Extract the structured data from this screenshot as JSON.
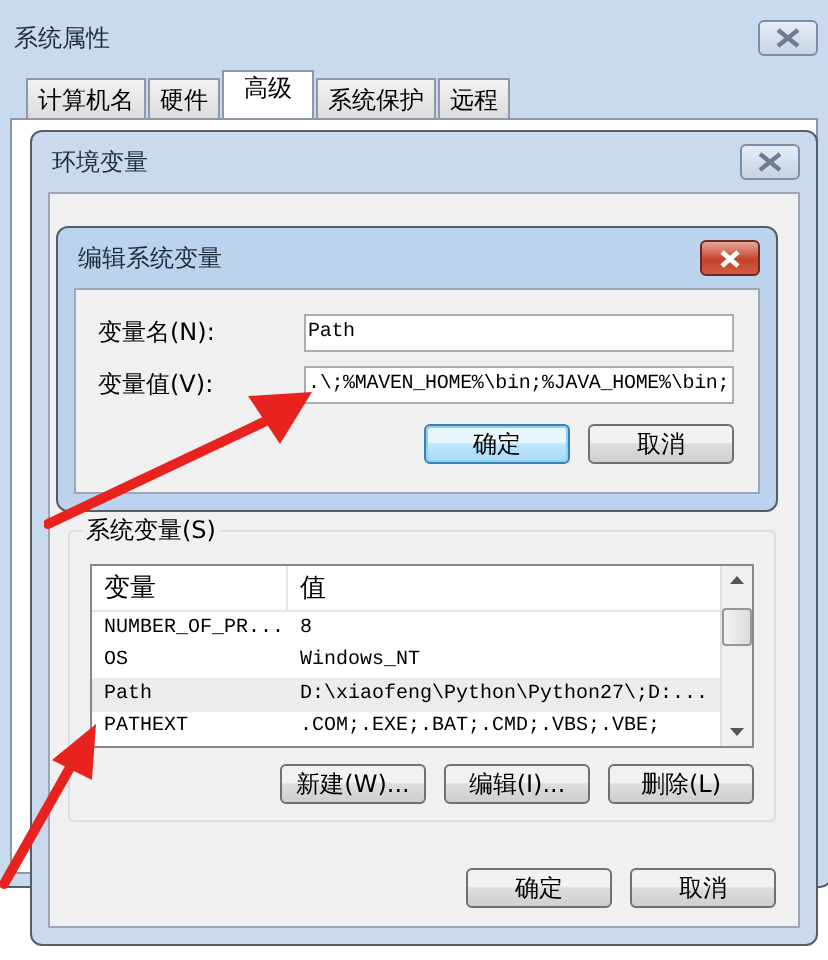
{
  "window": {
    "title": "系统属性"
  },
  "tabs": [
    {
      "label": "计算机名",
      "selected": false
    },
    {
      "label": "硬件",
      "selected": false
    },
    {
      "label": "高级",
      "selected": true
    },
    {
      "label": "系统保护",
      "selected": false
    },
    {
      "label": "远程",
      "selected": false
    }
  ],
  "env_dialog": {
    "title": "环境变量",
    "system_vars": {
      "label": "系统变量(S)",
      "columns": [
        "变量",
        "值"
      ],
      "rows": [
        {
          "name": "NUMBER_OF_PR...",
          "value": "8",
          "selected": false
        },
        {
          "name": "OS",
          "value": "Windows_NT",
          "selected": false
        },
        {
          "name": "Path",
          "value": "D:\\xiaofeng\\Python\\Python27\\;D:...",
          "selected": true
        },
        {
          "name": "PATHEXT",
          "value": ".COM;.EXE;.BAT;.CMD;.VBS;.VBE;",
          "selected": false
        }
      ],
      "buttons": [
        "新建(W)...",
        "编辑(I)...",
        "删除(L)"
      ]
    },
    "buttons": [
      "确定",
      "取消"
    ]
  },
  "edit_dialog": {
    "title": "编辑系统变量",
    "fields": [
      {
        "label": "变量名(N):",
        "value": "Path"
      },
      {
        "label": "变量值(V):",
        "value": ".\\;%MAVEN_HOME%\\bin;%JAVA_HOME%\\bin;"
      }
    ],
    "buttons": [
      {
        "label": "确定",
        "default": true
      },
      {
        "label": "取消",
        "default": false
      }
    ]
  }
}
